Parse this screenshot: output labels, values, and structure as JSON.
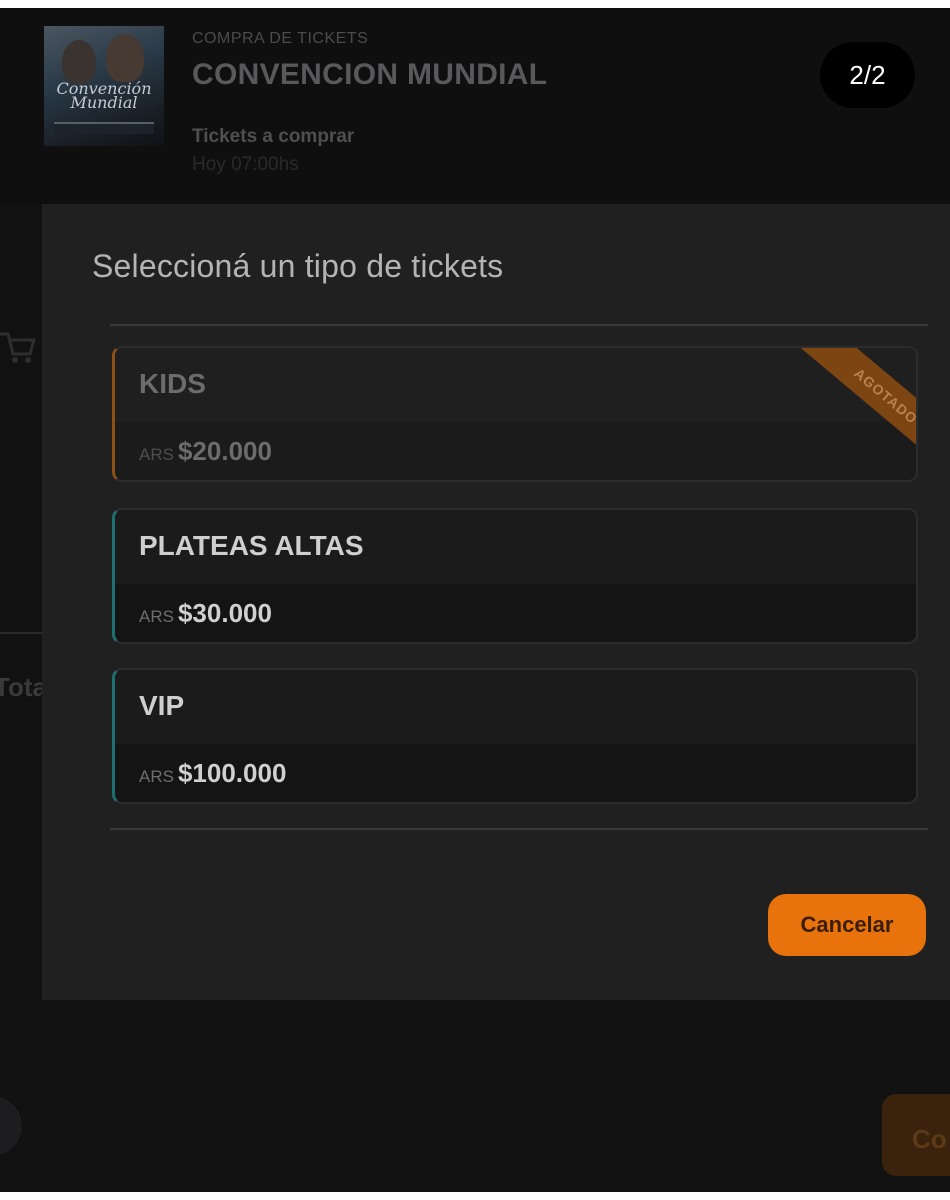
{
  "header": {
    "eyebrow": "COMPRA DE TICKETS",
    "event_title": "CONVENCION MUNDIAL",
    "subtitle": "Tickets a comprar",
    "time": "Hoy 07:00hs",
    "poster_text": "Convención Mundial",
    "page_counter": "2/2"
  },
  "background": {
    "total_label": "Tota",
    "continue_label": "Co"
  },
  "modal": {
    "title": "Seleccioná un tipo de tickets",
    "tickets": [
      {
        "name": "KIDS",
        "currency": "ARS",
        "price": "$20.000",
        "badge": "AGOTADO",
        "sold_out": true
      },
      {
        "name": "PLATEAS ALTAS",
        "currency": "ARS",
        "price": "$30.000",
        "sold_out": false
      },
      {
        "name": "VIP",
        "currency": "ARS",
        "price": "$100.000",
        "sold_out": false
      }
    ],
    "cancel_label": "Cancelar"
  },
  "colors": {
    "accent": "#e8720c",
    "soldout_ribbon": "#7c4511",
    "available_edge": "#1d6f73",
    "modal_bg": "#202021"
  },
  "icons": [
    "cart-icon"
  ]
}
